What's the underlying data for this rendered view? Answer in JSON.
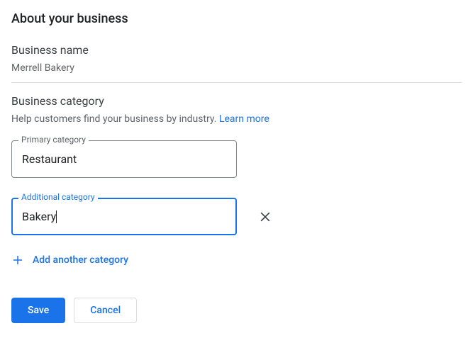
{
  "title": "About your business",
  "businessName": {
    "label": "Business name",
    "value": "Merrell Bakery"
  },
  "businessCategory": {
    "label": "Business category",
    "helper": "Help customers find your business by industry. ",
    "learnMore": "Learn more"
  },
  "primaryCategory": {
    "label": "Primary category",
    "value": "Restaurant"
  },
  "additionalCategory": {
    "label": "Additional category",
    "value": "Bakery"
  },
  "addAnother": "Add another category",
  "buttons": {
    "save": "Save",
    "cancel": "Cancel"
  }
}
